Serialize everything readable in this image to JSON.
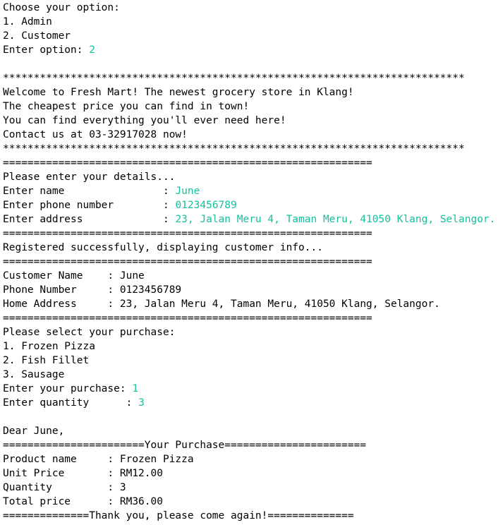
{
  "colors": {
    "background": "#ffffff",
    "output_text": "#000000",
    "user_input": "#16c09a"
  },
  "console": {
    "lines": [
      {
        "text": "Choose your option:"
      },
      {
        "text": "1. Admin"
      },
      {
        "text": "2. Customer"
      },
      {
        "text": "Enter option: ",
        "input": "2"
      },
      {
        "text": ""
      },
      {
        "text": "***************************************************************************"
      },
      {
        "text": "Welcome to Fresh Mart! The newest grocery store in Klang!"
      },
      {
        "text": "The cheapest price you can find in town!"
      },
      {
        "text": "You can find everything you'll ever need here!"
      },
      {
        "text": "Contact us at 03-32917028 now!"
      },
      {
        "text": "***************************************************************************"
      },
      {
        "text": "============================================================"
      },
      {
        "text": "Please enter your details..."
      },
      {
        "text": "Enter name                : ",
        "input": "June"
      },
      {
        "text": "Enter phone number        : ",
        "input": "0123456789"
      },
      {
        "text": "Enter address             : ",
        "input": "23, Jalan Meru 4, Taman Meru, 41050 Klang, Selangor."
      },
      {
        "text": "============================================================"
      },
      {
        "text": "Registered successfully, displaying customer info..."
      },
      {
        "text": "============================================================"
      },
      {
        "text": "Customer Name    : June"
      },
      {
        "text": "Phone Number     : 0123456789"
      },
      {
        "text": "Home Address     : 23, Jalan Meru 4, Taman Meru, 41050 Klang, Selangor."
      },
      {
        "text": "============================================================"
      },
      {
        "text": "Please select your purchase:"
      },
      {
        "text": "1. Frozen Pizza"
      },
      {
        "text": "2. Fish Fillet"
      },
      {
        "text": "3. Sausage"
      },
      {
        "text": "Enter your purchase: ",
        "input": "1"
      },
      {
        "text": "Enter quantity      : ",
        "input": "3"
      },
      {
        "text": ""
      },
      {
        "text": "Dear June,"
      },
      {
        "text": "=======================Your Purchase======================="
      },
      {
        "text": "Product name     : Frozen Pizza"
      },
      {
        "text": "Unit Price       : RM12.00"
      },
      {
        "text": "Quantity         : 3"
      },
      {
        "text": "Total price      : RM36.00"
      },
      {
        "text": "==============Thank you, please come again!=============="
      }
    ]
  }
}
